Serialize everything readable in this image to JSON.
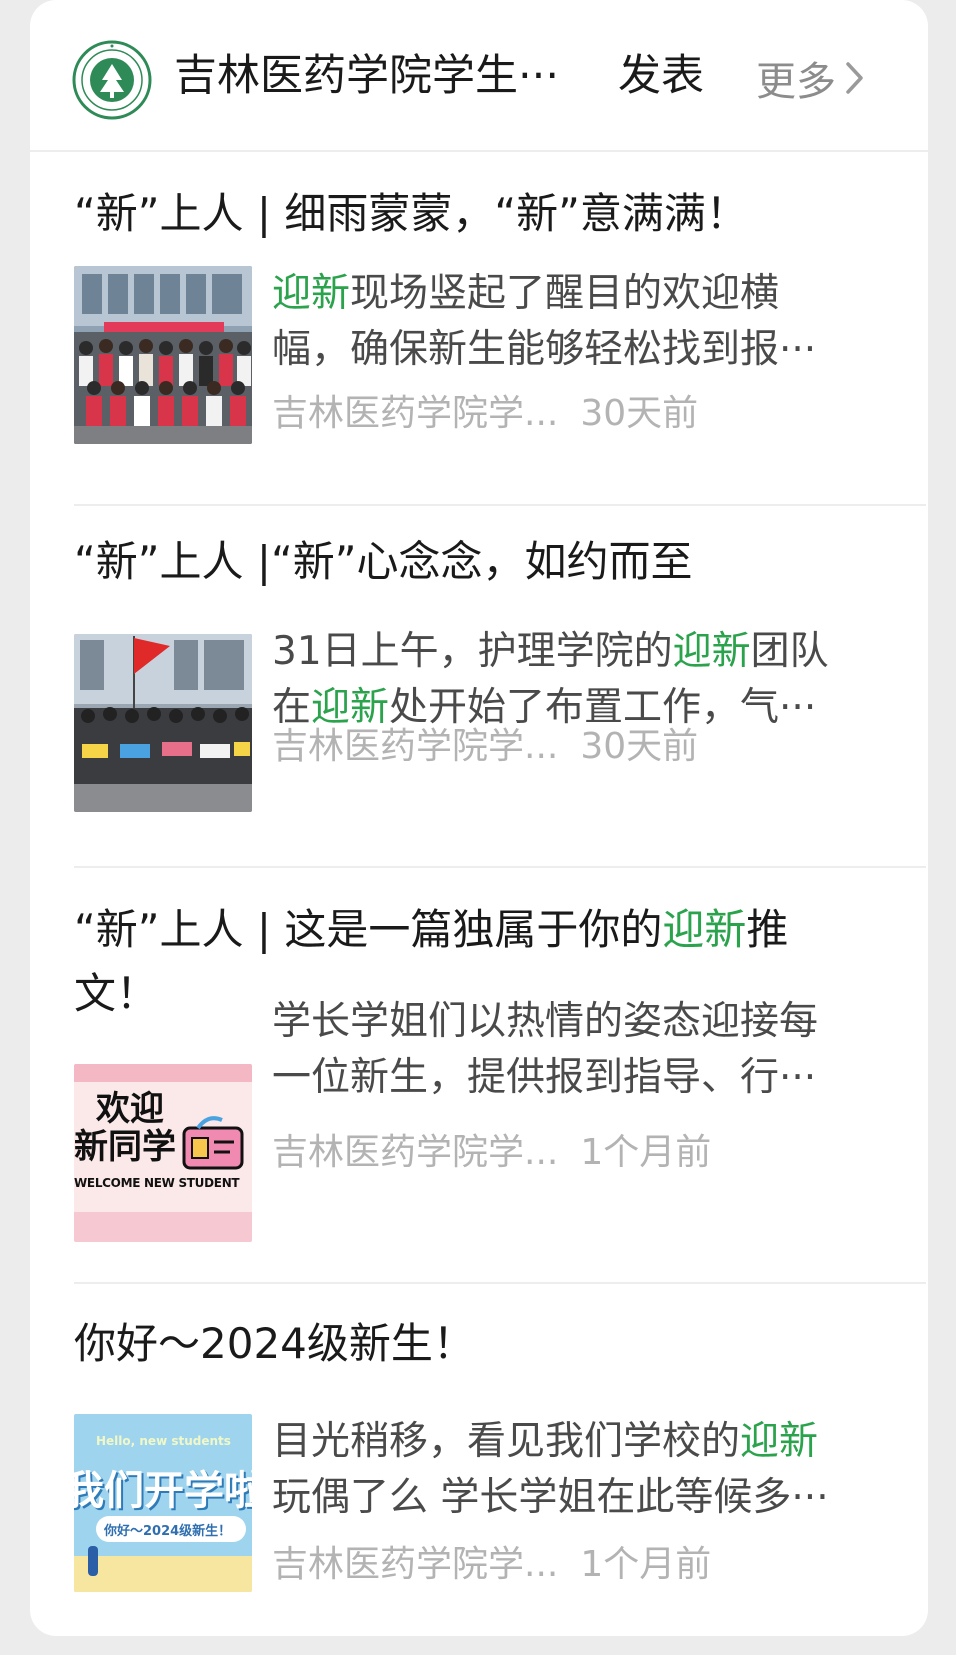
{
  "header": {
    "account_name": "吉林医药学院学生···",
    "published_label": "发表",
    "more_label": "更多",
    "chevron_icon": "chevron-right-icon",
    "logo_icon": "university-logo"
  },
  "colors": {
    "accent": "#2ba24c",
    "muted": "#b3b3b3",
    "summary": "#4a4a4a"
  },
  "articles": [
    {
      "title_parts": [
        "“新”上人 | 细雨蒙蒙，“新”意满满！"
      ],
      "summary_line1_hl": "迎新",
      "summary_line1_rest": "现场竖起了醒目的欢迎横",
      "summary_line2": "幅，确保新生能够轻松找到报···",
      "source": "吉林医药学院学...",
      "time": "30天前"
    },
    {
      "title_parts": [
        "“新”上人 |“新”心念念，如约而至"
      ],
      "summary_line1_pre": "31日上午，护理学院的",
      "summary_line1_hl": "迎新",
      "summary_line1_post": "团队",
      "summary_line2_pre": "在",
      "summary_line2_hl": "迎新",
      "summary_line2_post": "处开始了布置工作，气···",
      "source": "吉林医药学院学...",
      "time": "30天前"
    },
    {
      "title_pre": "“新”上人 | 这是一篇独属于你的",
      "title_hl": "迎新",
      "title_post": "推",
      "title_line2": "文！",
      "thumb_text1": "欢迎",
      "thumb_text2": "新同学",
      "thumb_text3": "WELCOME NEW STUDENT",
      "summary_line1": "学长学姐们以热情的姿态迎接每",
      "summary_line2": "一位新生，提供报到指导、行···",
      "source": "吉林医药学院学...",
      "time": "1个月前"
    },
    {
      "title": "你好～2024级新生！",
      "thumb_text1": "Hello, new students",
      "thumb_text2": "我们开学啦",
      "thumb_text3": "你好～2024级新生！",
      "summary_line1_pre": "目光稍移，看见我们学校的",
      "summary_line1_hl": "迎新",
      "summary_line2": "玩偶了么 学长学姐在此等候多···",
      "source": "吉林医药学院学...",
      "time": "1个月前"
    }
  ]
}
